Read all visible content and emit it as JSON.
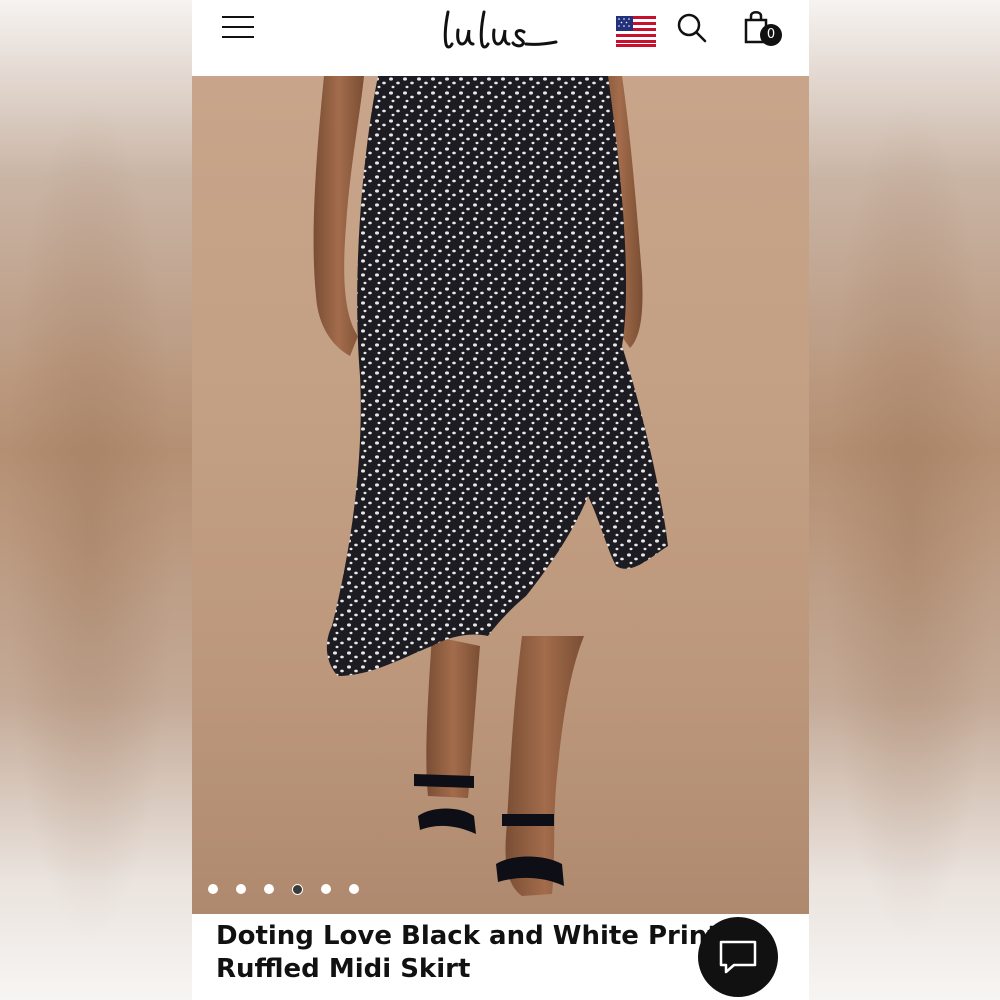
{
  "header": {
    "logo_text": "lulus",
    "menu_icon": "hamburger-menu-icon",
    "flag_icon": "us-flag-icon",
    "search_icon": "search-icon",
    "bag_icon": "shopping-bag-icon",
    "bag_count": "0"
  },
  "gallery": {
    "image_description_icon": "product-photo",
    "dot_count": 6,
    "active_dot": 4
  },
  "product": {
    "title": "Doting Love Black and White Print Ruffled Midi Skirt"
  },
  "chat": {
    "icon": "chat-bubble-icon"
  },
  "colors": {
    "brand_dark": "#111111",
    "background_photo": "#c39f83"
  }
}
